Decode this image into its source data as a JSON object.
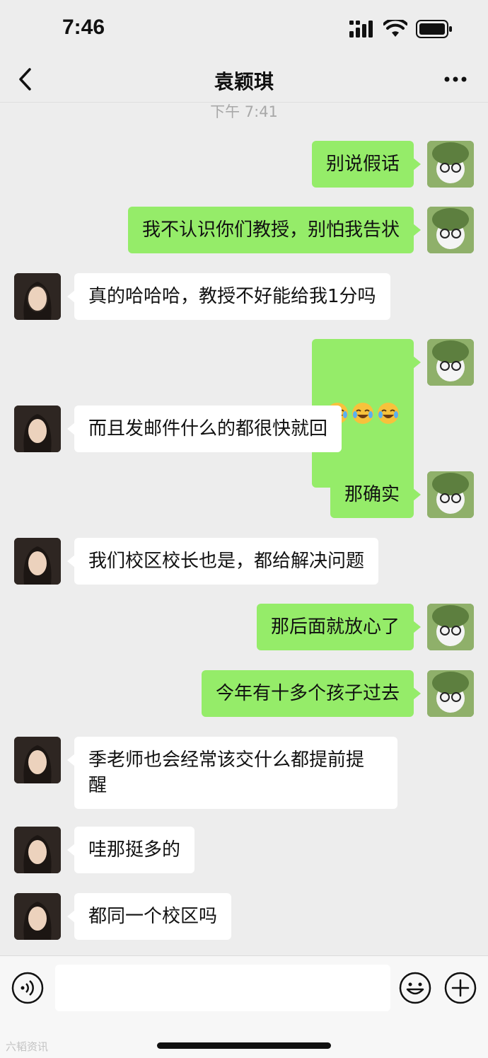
{
  "status_bar": {
    "time": "7:46"
  },
  "header": {
    "title": "袁颖琪"
  },
  "timestamp": "下午 7:41",
  "messages": [
    {
      "from": "me",
      "text": "别说假话"
    },
    {
      "from": "me",
      "text": "我不认识你们教授，别怕我告状"
    },
    {
      "from": "other",
      "text": "真的哈哈哈，教授不好能给我1分吗"
    },
    {
      "from": "me",
      "emoji": [
        "crying-laughing-emoji",
        "crying-laughing-emoji",
        "crying-laughing-emoji"
      ]
    },
    {
      "from": "other",
      "text": "而且发邮件什么的都很快就回"
    },
    {
      "from": "me",
      "text": "那确实"
    },
    {
      "from": "other",
      "text": "我们校区校长也是，都给解决问题"
    },
    {
      "from": "me",
      "text": "那后面就放心了"
    },
    {
      "from": "me",
      "text": "今年有十多个孩子过去"
    },
    {
      "from": "other",
      "text": "季老师也会经常该交什么都提前提\n醒"
    },
    {
      "from": "other",
      "text": "哇那挺多的"
    },
    {
      "from": "other",
      "text": "都同一个校区吗"
    }
  ],
  "input_bar": {
    "text_value": ""
  },
  "watermark": "六韬资讯",
  "colors": {
    "sent_bubble": "#95ec69",
    "received_bubble": "#ffffff",
    "background": "#ededed"
  }
}
